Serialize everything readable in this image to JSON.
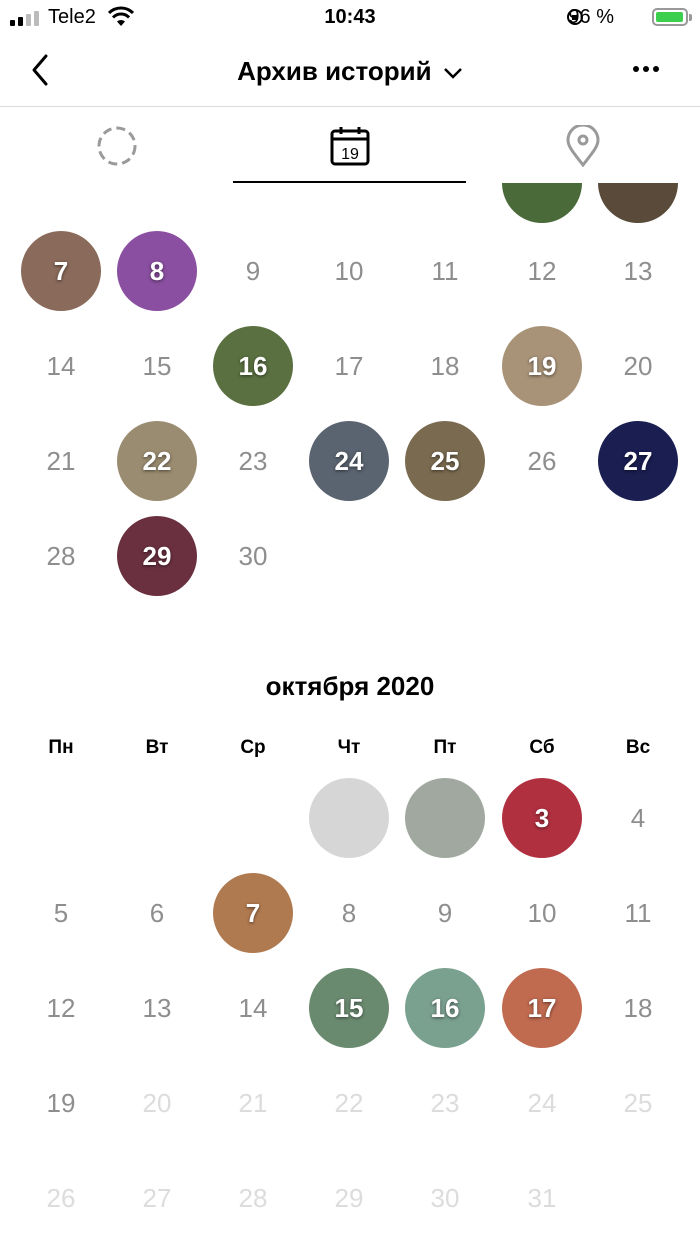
{
  "status": {
    "carrier": "Tele2",
    "time": "10:43",
    "battery": "96 %"
  },
  "nav": {
    "title": "Архив историй"
  },
  "tabs": [
    {
      "name": "tab-grid",
      "icon": "circle-dashed-icon"
    },
    {
      "name": "tab-calendar",
      "icon": "calendar-icon",
      "label": "19"
    },
    {
      "name": "tab-map",
      "icon": "location-pin-icon"
    }
  ],
  "september": {
    "rows": [
      [
        {
          "d": "7",
          "s": 1,
          "c": "#8a6a5a"
        },
        {
          "d": "8",
          "s": 1,
          "c": "#8a4fa0"
        },
        {
          "d": "9"
        },
        {
          "d": "10"
        },
        {
          "d": "11"
        },
        {
          "d": "12"
        },
        {
          "d": "13"
        }
      ],
      [
        {
          "d": "14"
        },
        {
          "d": "15"
        },
        {
          "d": "16",
          "s": 1,
          "c": "#5a7040"
        },
        {
          "d": "17"
        },
        {
          "d": "18"
        },
        {
          "d": "19",
          "s": 1,
          "c": "#a89278"
        },
        {
          "d": "20"
        }
      ],
      [
        {
          "d": "21"
        },
        {
          "d": "22",
          "s": 1,
          "c": "#9a8c70"
        },
        {
          "d": "23"
        },
        {
          "d": "24",
          "s": 1,
          "c": "#5a6470"
        },
        {
          "d": "25",
          "s": 1,
          "c": "#7a6a50"
        },
        {
          "d": "26"
        },
        {
          "d": "27",
          "s": 1,
          "c": "#1a1e50"
        }
      ],
      [
        {
          "d": "28"
        },
        {
          "d": "29",
          "s": 1,
          "c": "#6a3040"
        },
        {
          "d": "30"
        }
      ]
    ]
  },
  "october": {
    "title": "октября 2020",
    "weekdays": [
      "Пн",
      "Вт",
      "Ср",
      "Чт",
      "Пт",
      "Сб",
      "Вс"
    ],
    "rows": [
      [
        null,
        null,
        null,
        {
          "d": "",
          "s": 1,
          "c": "#d6d6d6"
        },
        {
          "d": "",
          "s": 1,
          "c": "#a0a8a0"
        },
        {
          "d": "3",
          "s": 1,
          "c": "#b03040"
        },
        {
          "d": "4"
        }
      ],
      [
        {
          "d": "5"
        },
        {
          "d": "6"
        },
        {
          "d": "7",
          "s": 1,
          "c": "#b07a50"
        },
        {
          "d": "8"
        },
        {
          "d": "9"
        },
        {
          "d": "10"
        },
        {
          "d": "11"
        }
      ],
      [
        {
          "d": "12"
        },
        {
          "d": "13"
        },
        {
          "d": "14"
        },
        {
          "d": "15",
          "s": 1,
          "c": "#6a8a70"
        },
        {
          "d": "16",
          "s": 1,
          "c": "#7aa090"
        },
        {
          "d": "17",
          "s": 1,
          "c": "#c06a50"
        },
        {
          "d": "18"
        }
      ],
      [
        {
          "d": "19"
        },
        {
          "d": "20",
          "f": 1
        },
        {
          "d": "21",
          "f": 1
        },
        {
          "d": "22",
          "f": 1
        },
        {
          "d": "23",
          "f": 1
        },
        {
          "d": "24",
          "f": 1
        },
        {
          "d": "25",
          "f": 1
        }
      ],
      [
        {
          "d": "26",
          "f": 1
        },
        {
          "d": "27",
          "f": 1
        },
        {
          "d": "28",
          "f": 1
        },
        {
          "d": "29",
          "f": 1
        },
        {
          "d": "30",
          "f": 1
        },
        {
          "d": "31",
          "f": 1
        }
      ]
    ]
  }
}
